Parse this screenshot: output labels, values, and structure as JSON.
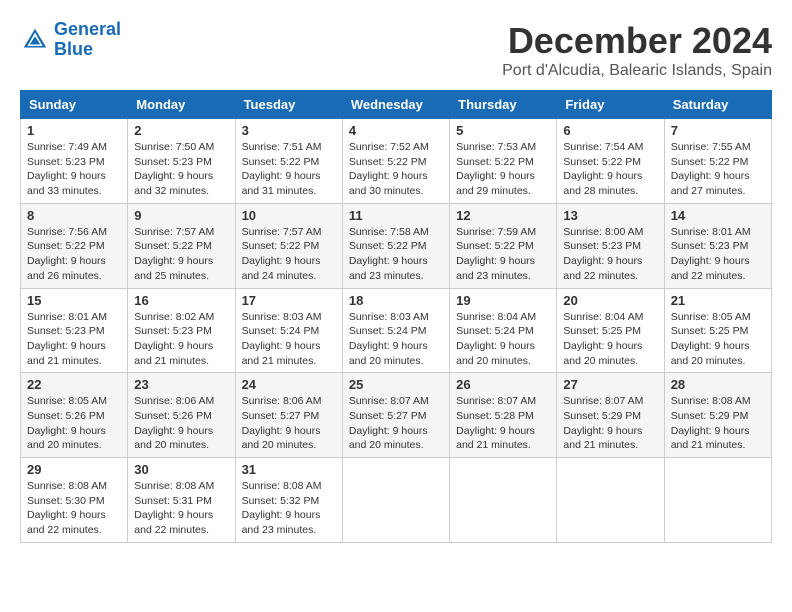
{
  "logo": {
    "line1": "General",
    "line2": "Blue"
  },
  "title": "December 2024",
  "subtitle": "Port d'Alcudia, Balearic Islands, Spain",
  "days_of_week": [
    "Sunday",
    "Monday",
    "Tuesday",
    "Wednesday",
    "Thursday",
    "Friday",
    "Saturday"
  ],
  "weeks": [
    [
      {
        "day": "1",
        "sunrise": "7:49 AM",
        "sunset": "5:23 PM",
        "daylight": "9 hours and 33 minutes."
      },
      {
        "day": "2",
        "sunrise": "7:50 AM",
        "sunset": "5:23 PM",
        "daylight": "9 hours and 32 minutes."
      },
      {
        "day": "3",
        "sunrise": "7:51 AM",
        "sunset": "5:22 PM",
        "daylight": "9 hours and 31 minutes."
      },
      {
        "day": "4",
        "sunrise": "7:52 AM",
        "sunset": "5:22 PM",
        "daylight": "9 hours and 30 minutes."
      },
      {
        "day": "5",
        "sunrise": "7:53 AM",
        "sunset": "5:22 PM",
        "daylight": "9 hours and 29 minutes."
      },
      {
        "day": "6",
        "sunrise": "7:54 AM",
        "sunset": "5:22 PM",
        "daylight": "9 hours and 28 minutes."
      },
      {
        "day": "7",
        "sunrise": "7:55 AM",
        "sunset": "5:22 PM",
        "daylight": "9 hours and 27 minutes."
      }
    ],
    [
      {
        "day": "8",
        "sunrise": "7:56 AM",
        "sunset": "5:22 PM",
        "daylight": "9 hours and 26 minutes."
      },
      {
        "day": "9",
        "sunrise": "7:57 AM",
        "sunset": "5:22 PM",
        "daylight": "9 hours and 25 minutes."
      },
      {
        "day": "10",
        "sunrise": "7:57 AM",
        "sunset": "5:22 PM",
        "daylight": "9 hours and 24 minutes."
      },
      {
        "day": "11",
        "sunrise": "7:58 AM",
        "sunset": "5:22 PM",
        "daylight": "9 hours and 23 minutes."
      },
      {
        "day": "12",
        "sunrise": "7:59 AM",
        "sunset": "5:22 PM",
        "daylight": "9 hours and 23 minutes."
      },
      {
        "day": "13",
        "sunrise": "8:00 AM",
        "sunset": "5:23 PM",
        "daylight": "9 hours and 22 minutes."
      },
      {
        "day": "14",
        "sunrise": "8:01 AM",
        "sunset": "5:23 PM",
        "daylight": "9 hours and 22 minutes."
      }
    ],
    [
      {
        "day": "15",
        "sunrise": "8:01 AM",
        "sunset": "5:23 PM",
        "daylight": "9 hours and 21 minutes."
      },
      {
        "day": "16",
        "sunrise": "8:02 AM",
        "sunset": "5:23 PM",
        "daylight": "9 hours and 21 minutes."
      },
      {
        "day": "17",
        "sunrise": "8:03 AM",
        "sunset": "5:24 PM",
        "daylight": "9 hours and 21 minutes."
      },
      {
        "day": "18",
        "sunrise": "8:03 AM",
        "sunset": "5:24 PM",
        "daylight": "9 hours and 20 minutes."
      },
      {
        "day": "19",
        "sunrise": "8:04 AM",
        "sunset": "5:24 PM",
        "daylight": "9 hours and 20 minutes."
      },
      {
        "day": "20",
        "sunrise": "8:04 AM",
        "sunset": "5:25 PM",
        "daylight": "9 hours and 20 minutes."
      },
      {
        "day": "21",
        "sunrise": "8:05 AM",
        "sunset": "5:25 PM",
        "daylight": "9 hours and 20 minutes."
      }
    ],
    [
      {
        "day": "22",
        "sunrise": "8:05 AM",
        "sunset": "5:26 PM",
        "daylight": "9 hours and 20 minutes."
      },
      {
        "day": "23",
        "sunrise": "8:06 AM",
        "sunset": "5:26 PM",
        "daylight": "9 hours and 20 minutes."
      },
      {
        "day": "24",
        "sunrise": "8:06 AM",
        "sunset": "5:27 PM",
        "daylight": "9 hours and 20 minutes."
      },
      {
        "day": "25",
        "sunrise": "8:07 AM",
        "sunset": "5:27 PM",
        "daylight": "9 hours and 20 minutes."
      },
      {
        "day": "26",
        "sunrise": "8:07 AM",
        "sunset": "5:28 PM",
        "daylight": "9 hours and 21 minutes."
      },
      {
        "day": "27",
        "sunrise": "8:07 AM",
        "sunset": "5:29 PM",
        "daylight": "9 hours and 21 minutes."
      },
      {
        "day": "28",
        "sunrise": "8:08 AM",
        "sunset": "5:29 PM",
        "daylight": "9 hours and 21 minutes."
      }
    ],
    [
      {
        "day": "29",
        "sunrise": "8:08 AM",
        "sunset": "5:30 PM",
        "daylight": "9 hours and 22 minutes."
      },
      {
        "day": "30",
        "sunrise": "8:08 AM",
        "sunset": "5:31 PM",
        "daylight": "9 hours and 22 minutes."
      },
      {
        "day": "31",
        "sunrise": "8:08 AM",
        "sunset": "5:32 PM",
        "daylight": "9 hours and 23 minutes."
      },
      null,
      null,
      null,
      null
    ]
  ]
}
